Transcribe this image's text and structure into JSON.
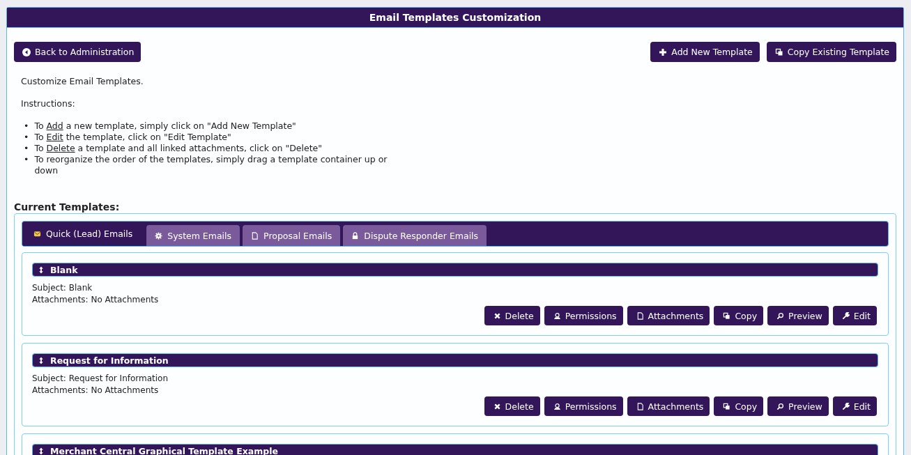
{
  "window": {
    "title": "Email Templates Customization"
  },
  "back_button": {
    "label": "Back to Administration",
    "kind": "back"
  },
  "top_actions": [
    {
      "label": "Add New Template",
      "kind": "add"
    },
    {
      "label": "Copy Existing Template",
      "kind": "copy"
    }
  ],
  "intro": "Customize Email Templates.",
  "instructions_heading": "Instructions:",
  "instructions": [
    {
      "marker": "•",
      "before": "To ",
      "underlined": "Add",
      "after": " a new template, simply click on \"Add New Template\""
    },
    {
      "marker": "•",
      "before": "To ",
      "underlined": "Edit",
      "after": " the template, click on \"Edit Template\""
    },
    {
      "marker": "•",
      "before": "To ",
      "underlined": "Delete",
      "after": " a template and all linked attachments, click on \"Delete\""
    },
    {
      "marker": "•",
      "before": "To reorganize the order of the templates, simply drag a template container up or down"
    }
  ],
  "section_title": "Current Templates:",
  "tabs": [
    {
      "label": "Quick (Lead) Emails",
      "kind": "mail",
      "selected": true
    },
    {
      "label": "System Emails",
      "kind": "gear",
      "selected": false
    },
    {
      "label": "Proposal Emails",
      "kind": "doc",
      "selected": false
    },
    {
      "label": "Dispute Responder Emails",
      "kind": "lock",
      "selected": false
    }
  ],
  "templates": [
    {
      "name": "Blank",
      "subject": "Subject: Blank",
      "attachments": "Attachments: No Attachments",
      "actions": [
        {
          "label": "Delete",
          "kind": "delete"
        },
        {
          "label": "Permissions",
          "kind": "user"
        },
        {
          "label": "Attachments",
          "kind": "doc"
        },
        {
          "label": "Copy",
          "kind": "copy"
        },
        {
          "label": "Preview",
          "kind": "preview"
        },
        {
          "label": "Edit",
          "kind": "edit"
        }
      ]
    },
    {
      "name": "Request for Information",
      "subject": "Subject: Request for Information",
      "attachments": "Attachments: No Attachments",
      "actions": [
        {
          "label": "Delete",
          "kind": "delete"
        },
        {
          "label": "Permissions",
          "kind": "user"
        },
        {
          "label": "Attachments",
          "kind": "doc"
        },
        {
          "label": "Copy",
          "kind": "copy"
        },
        {
          "label": "Preview",
          "kind": "preview"
        },
        {
          "label": "Edit",
          "kind": "edit"
        }
      ]
    },
    {
      "name": "Merchant Central Graphical Template Example"
    }
  ]
}
